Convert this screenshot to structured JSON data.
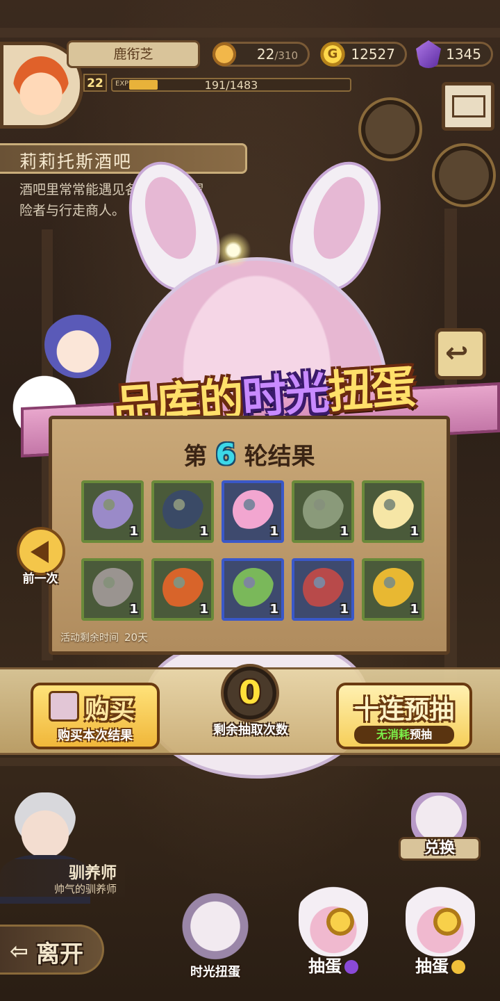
{
  "player": {
    "name": "鹿衔芝",
    "level": "22",
    "exp_label": "EXP",
    "exp_text": "191/1483",
    "exp_fraction": 0.129
  },
  "resources": {
    "stamina": "22",
    "stamina_max": "/310",
    "gold": "12527",
    "gold_icon_letter": "G",
    "gems": "1345"
  },
  "location": {
    "name": "莉莉托斯酒吧",
    "description_lines": [
      "酒吧里常常能遇见各种各样的冒",
      "险者与行走商人。"
    ]
  },
  "banner": {
    "title_pre": "品库的",
    "title_highlight": "时光",
    "title_post": "扭蛋"
  },
  "result": {
    "round_prefix": "第",
    "round_number": "6",
    "round_suffix": "轮结果",
    "items": [
      {
        "name": "purple-bulb-icon",
        "count": "1",
        "rare": false,
        "color": "#9a8ac8"
      },
      {
        "name": "dark-shell-icon",
        "count": "1",
        "rare": false,
        "color": "#3a4a66"
      },
      {
        "name": "pink-slime-icon",
        "count": "1",
        "rare": true,
        "color": "#f2a6d0"
      },
      {
        "name": "leaf-seed-icon",
        "count": "1",
        "rare": false,
        "color": "#8a9a7a"
      },
      {
        "name": "dome-crystal-icon",
        "count": "1",
        "rare": false,
        "color": "#f6e6a6"
      },
      {
        "name": "gray-fur-icon",
        "count": "1",
        "rare": false,
        "color": "#9a9490"
      },
      {
        "name": "fire-egg-icon",
        "count": "1",
        "rare": false,
        "color": "#d8642a"
      },
      {
        "name": "green-cabbage-icon",
        "count": "1",
        "rare": true,
        "color": "#7ab85a"
      },
      {
        "name": "red-helmet-icon",
        "count": "1",
        "rare": true,
        "color": "#b84a4a"
      },
      {
        "name": "gold-jelly-icon",
        "count": "1",
        "rare": false,
        "color": "#e8b832"
      }
    ],
    "event_time_label": "活动剩余时间",
    "event_time_value": "20天"
  },
  "actions": {
    "prev_label": "前一次",
    "buy_big": "购买",
    "buy_small": "购买本次结果",
    "remaining_count": "0",
    "remaining_label": "剩余抽取次数",
    "ten_big": "十连预抽",
    "ten_small_green": "无消耗",
    "ten_small_white": "预抽"
  },
  "npc": {
    "name": "驯养师",
    "title": "帅气的驯养师"
  },
  "nav": {
    "exchange": "兑换",
    "leave": "离开",
    "time_gacha": "时光扭蛋",
    "gacha_gem": "抽蛋",
    "gacha_gold": "抽蛋"
  },
  "colors": {
    "gem": "#8a4ad8",
    "gold": "#f0c03a"
  }
}
